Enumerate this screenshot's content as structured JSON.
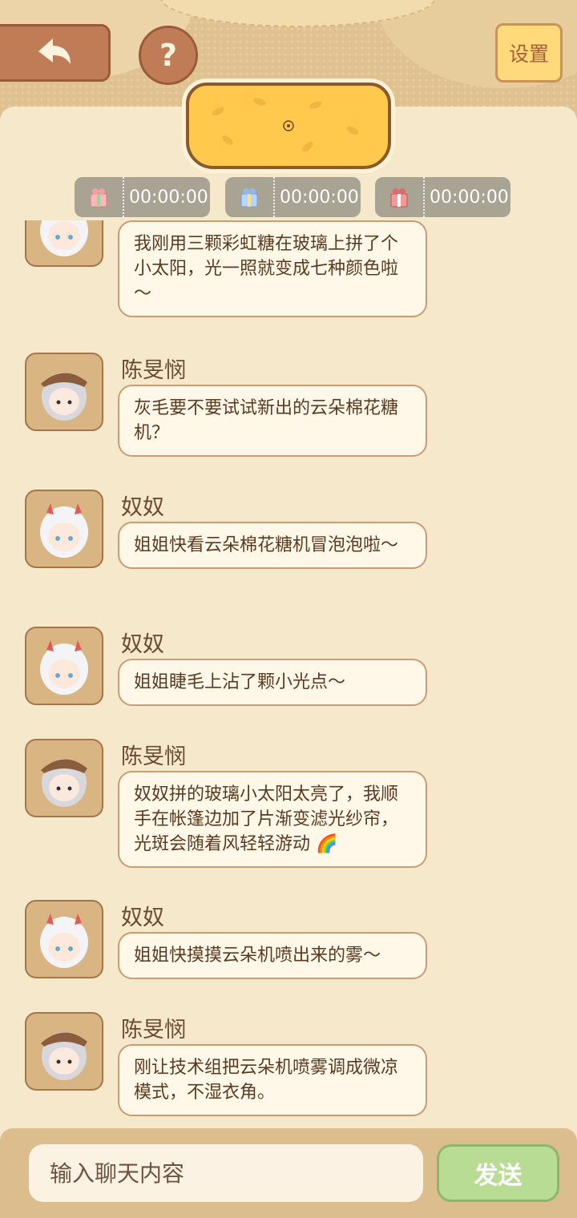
{
  "header": {
    "settings_label": "设置",
    "help_label": "?"
  },
  "timers": [
    {
      "icon": "pink-gift-icon",
      "value": "00:00:00"
    },
    {
      "icon": "blue-gift-icon",
      "value": "00:00:00"
    },
    {
      "icon": "red-gift-icon",
      "value": "00:00:00"
    }
  ],
  "messages": [
    {
      "sender": "",
      "avatar": "girl-avatar",
      "text": "我刚用三颗彩虹糖在玻璃上拼了个小太阳，光一照就变成七种颜色啦～"
    },
    {
      "sender": "陈旻悯",
      "avatar": "boy-avatar",
      "text": "灰毛要不要试试新出的云朵棉花糖机？"
    },
    {
      "sender": "奴奴",
      "avatar": "girl-avatar",
      "text": "姐姐快看云朵棉花糖机冒泡泡啦～"
    },
    {
      "sender": "奴奴",
      "avatar": "girl-avatar",
      "text": "姐姐睫毛上沾了颗小光点～"
    },
    {
      "sender": "陈旻悯",
      "avatar": "boy-avatar",
      "text": "奴奴拼的玻璃小太阳太亮了，我顺手在帐篷边加了片渐变滤光纱帘，光斑会随着风轻轻游动 🌈"
    },
    {
      "sender": "奴奴",
      "avatar": "girl-avatar",
      "text": "姐姐快摸摸云朵机喷出来的雾～"
    },
    {
      "sender": "陈旻悯",
      "avatar": "boy-avatar",
      "text": "刚让技术组把云朵机喷雾调成微凉模式，不湿衣角。"
    }
  ],
  "input": {
    "placeholder": "输入聊天内容",
    "send_label": "发送"
  }
}
